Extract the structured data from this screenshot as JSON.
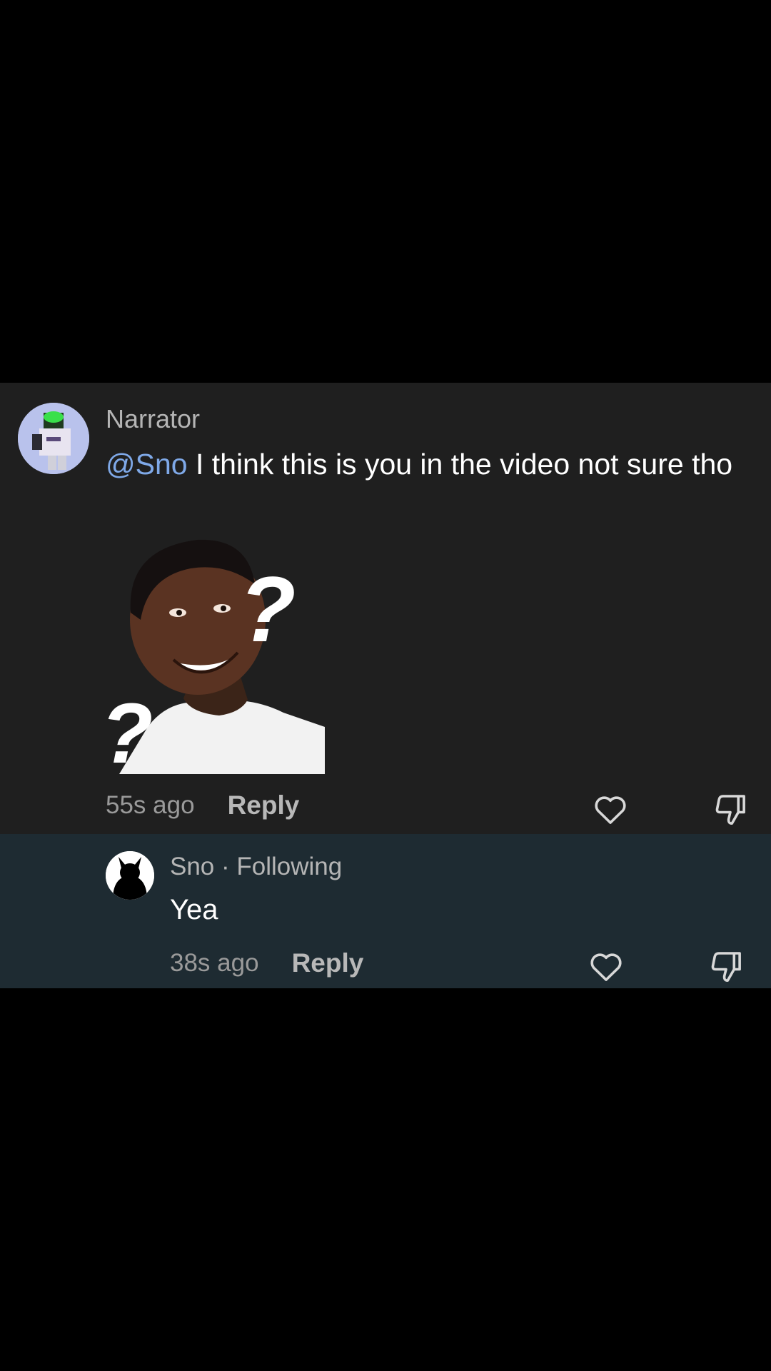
{
  "comment": {
    "username": "Narrator",
    "mention": "@Sno",
    "text": " I think this is you in the video not sure tho",
    "timestamp": "55s ago",
    "reply_label": "Reply",
    "meme": {
      "question_mark": "?"
    }
  },
  "reply": {
    "username": "Sno",
    "separator": " · ",
    "status": "Following",
    "text": "Yea",
    "timestamp": "38s ago",
    "reply_label": "Reply"
  },
  "icons": {
    "like": "heart-outline-icon",
    "dislike": "thumbs-down-icon"
  },
  "colors": {
    "card_bg": "#1f1f1f",
    "reply_bg": "#1e2b32",
    "mention": "#7fa9e8",
    "muted_text": "#9a9a9a"
  }
}
